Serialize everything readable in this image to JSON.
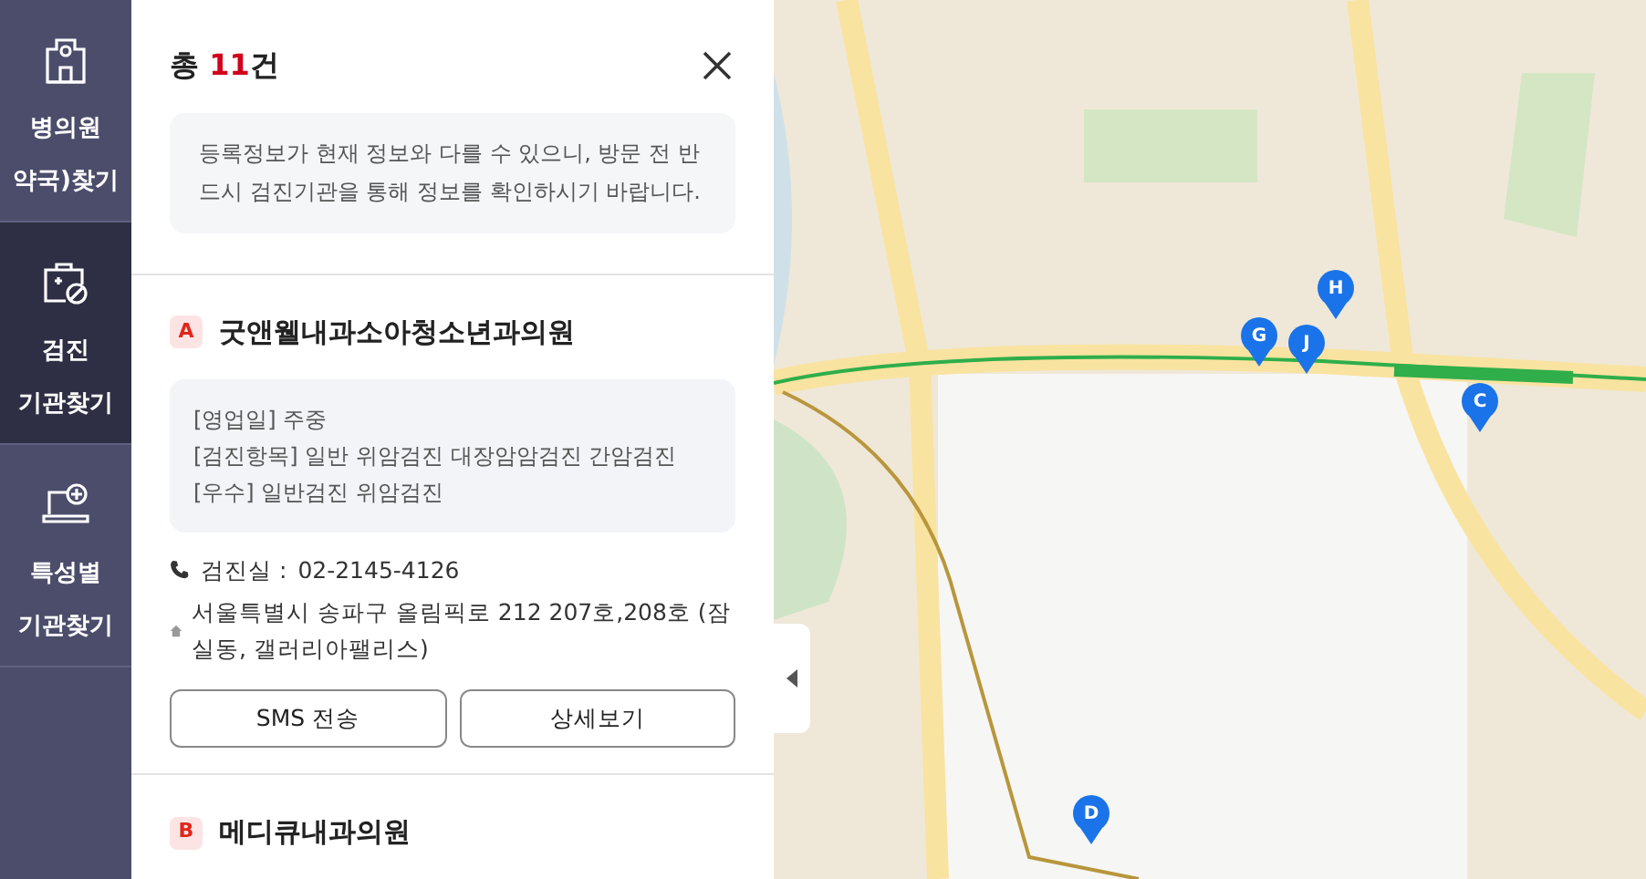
{
  "sidebar": {
    "items": [
      {
        "lines": [
          "병의원",
          "약국)찾기"
        ],
        "selected": false
      },
      {
        "lines": [
          "검진",
          "기관찾기"
        ],
        "selected": true
      },
      {
        "lines": [
          "특성별",
          "기관찾기"
        ],
        "selected": false
      }
    ]
  },
  "results": {
    "prefix": "총 ",
    "count": "11",
    "suffix": "건",
    "notice": "등록정보가 현재 정보와 다를 수 있으니, 방문 전 반드시 검진기관을 통해 정보를 확인하시기 바랍니다.",
    "items": [
      {
        "marker": "A",
        "name": "굿앤웰내과소아청소년과의원",
        "details": [
          "[영업일] 주중",
          "[검진항목] 일반 위암검진 대장암암검진 간암검진",
          "[우수] 일반검진 위암검진"
        ],
        "phone_label": "검진실 :",
        "phone": "02-2145-4126",
        "address": "서울특별시 송파구 올림픽로 212 207호,208호 (잠실동, 갤러리아팰리스)",
        "buttons": [
          "SMS 전송",
          "상세보기"
        ]
      },
      {
        "marker": "B",
        "name": "메디큐내과의원"
      }
    ]
  },
  "map": {
    "markers": [
      {
        "label": "H"
      },
      {
        "label": "G"
      },
      {
        "label": "J"
      },
      {
        "label": "C"
      },
      {
        "label": "D"
      }
    ]
  }
}
